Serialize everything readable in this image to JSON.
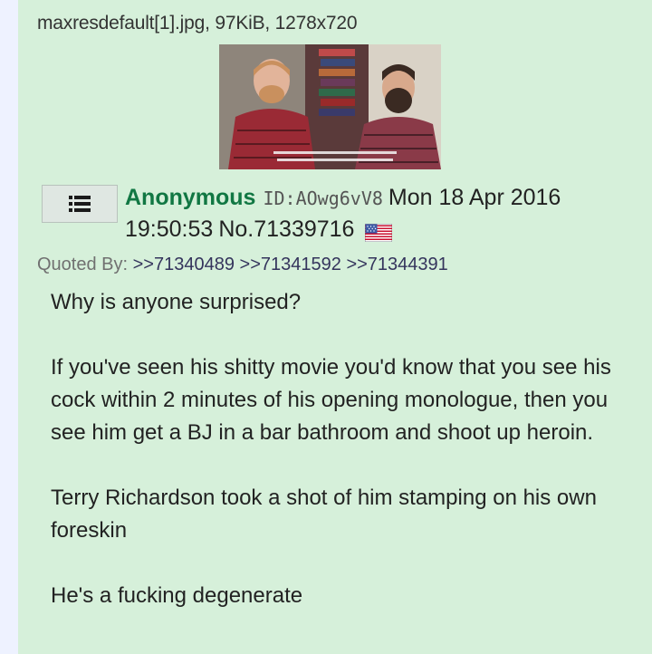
{
  "post": {
    "file_info": "maxresdefault[1].jpg, 97KiB, 1278x720",
    "thumbnail_icon": "video-still-thumbnail",
    "menu_icon": "hamburger-menu-icon",
    "name": "Anonymous",
    "user_id": "ID:AOwg6vV8",
    "date": "Mon 18 Apr 2016",
    "time": "19:50:53",
    "post_number": "No.71339716",
    "flag_icon": "us-flag-icon",
    "quoted_by_label": "Quoted By:",
    "quoted_by": [
      ">>71340489",
      ">>71341592",
      ">>71344391"
    ],
    "paragraphs": [
      "Why is anyone surprised?",
      "If you've seen his shitty movie you'd know that you see his cock within 2 minutes of his opening monologue, then you see him get a BJ in a bar bathroom and shoot up heroin.",
      "Terry Richardson took a shot of him stamping on his own foreskin",
      "He's a fucking degenerate"
    ]
  },
  "colors": {
    "post_background": "#d6f0da",
    "name": "#117743",
    "link": "#34345c"
  }
}
